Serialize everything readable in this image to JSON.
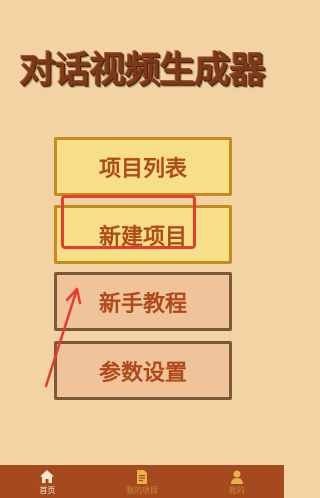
{
  "app": {
    "title": "对话视频生成器"
  },
  "menu": {
    "items": [
      {
        "label": "项目列表"
      },
      {
        "label": "新建项目"
      },
      {
        "label": "新手教程"
      },
      {
        "label": "参数设置"
      }
    ]
  },
  "bottom_nav": {
    "tabs": [
      {
        "label": "首页",
        "icon": "home-icon"
      },
      {
        "label": "我的项目",
        "icon": "document-icon"
      },
      {
        "label": "我的",
        "icon": "person-icon"
      }
    ]
  },
  "colors": {
    "background": "#f3d3a3",
    "title": "#7a3a1a",
    "button_text": "#b04a1b",
    "button_yellow_fill": "#f6df88",
    "button_yellow_border": "#c78a1d",
    "button_tan_fill": "#f0c49b",
    "button_tan_border": "#7b5a3b",
    "annotation_red": "#e53c2d",
    "bottom_bar": "#a44a1e"
  }
}
